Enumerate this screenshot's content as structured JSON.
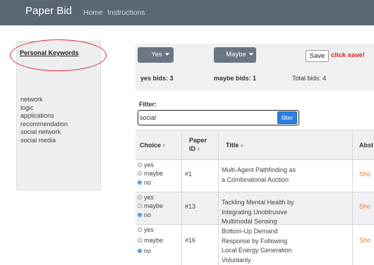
{
  "navbar": {
    "brand": "Paper Bid",
    "links": [
      "Home",
      "Instructions"
    ]
  },
  "keywords": {
    "title": "Personal Keywords",
    "items": [
      "network",
      "logic",
      "applications",
      "recommendation",
      "social network",
      "social media"
    ]
  },
  "bids": {
    "yes_label": "Yes",
    "maybe_label": "Maybe",
    "save_label": "Save",
    "click_save": "click save!",
    "yes_count": "yes bids: 3",
    "maybe_count": "maybe bids: 1",
    "total_count": "Total bids: 4"
  },
  "filter": {
    "label": "Filter:",
    "value": "social",
    "button": "filter"
  },
  "table": {
    "headers": {
      "choice": "Choice",
      "paper_id": "Paper ID",
      "title": "Title",
      "abstract": "Abst",
      "sort_icon": "♦"
    },
    "radio_labels": [
      "yes",
      "maybe",
      "no"
    ],
    "rows": [
      {
        "id": "#1",
        "title": "Multi-Agent Pathfinding as a Combinatorial Auction",
        "show": "Sho",
        "choice": "no"
      },
      {
        "id": "#13",
        "title": "Tackling Mental Health by Integrating Unobtrusive Multimodal Sensing",
        "show": "Sho",
        "choice": "no"
      },
      {
        "id": "#16",
        "title": "Bottom-Up Demand Response by Following Local Energy Generation Voluntarily",
        "show": "Sho",
        "choice": "no"
      }
    ]
  },
  "colors": {
    "navbar": "#5b6673",
    "dropdown": "#6b7682",
    "annotation": "#d52b2b",
    "click_save": "#e02020",
    "filter_button": "#2c7fe0",
    "show_link": "#e87722"
  }
}
